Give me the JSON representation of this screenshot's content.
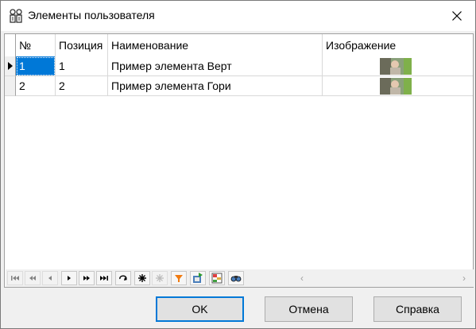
{
  "window": {
    "title": "Элементы пользователя",
    "close_glyph": "✕"
  },
  "grid": {
    "columns": [
      "№",
      "Позиция",
      "Наименование",
      "Изображение"
    ],
    "rows": [
      {
        "num": "1",
        "position": "1",
        "name": "Пример элемента Верт",
        "image": "thumbnail"
      },
      {
        "num": "2",
        "position": "2",
        "name": "Пример элемента Гори",
        "image": "thumbnail"
      }
    ],
    "selected_row": 1,
    "navigator": {
      "buttons": [
        "first",
        "prior-page",
        "prior",
        "next",
        "next-page",
        "last",
        "refresh",
        "insert",
        "delete",
        "filter",
        "export",
        "grid-settings",
        "find"
      ],
      "scroll_left": "‹",
      "scroll_right": "›"
    }
  },
  "buttons": {
    "ok": "OK",
    "cancel": "Отмена",
    "help": "Справка"
  },
  "colors": {
    "selection": "#0078d7",
    "default_border": "#0078d7"
  }
}
